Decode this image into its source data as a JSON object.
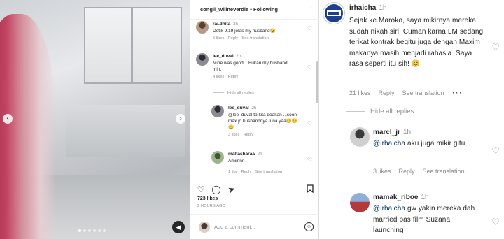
{
  "post": {
    "author": "congli_willneverdie",
    "follow_label": "Following",
    "likes": "723 likes",
    "date": "2 HOURS AGO",
    "add_comment_placeholder": "Add a comment...",
    "media_dot_count": 6,
    "comments": [
      {
        "username": "rai.dhita",
        "time": "2h",
        "text": "Detik 9.19 jelas my husband😉",
        "likes": "5 likes",
        "reply": "Reply",
        "see_translation": "See translation"
      },
      {
        "username": "lee_duval",
        "time": "2h",
        "text": "Mine was good... Bukan my husband, min.",
        "likes": "4 likes",
        "reply": "Reply"
      },
      {
        "username": "lee_duval",
        "time": "2h",
        "text": "@lee_duval tp kita doakan ...soon max jd husbandnya luna yaa😊😊😊",
        "likes": "3 likes",
        "reply": "Reply"
      },
      {
        "username": "maltasharaa",
        "time": "2h",
        "text": "Amiinnn",
        "likes": "1 like",
        "reply": "Reply",
        "see_translation": "See translation"
      }
    ],
    "hide_replies": "Hide all replies"
  },
  "thread": {
    "main": {
      "username": "irhaicha",
      "time": "1h",
      "text": "Sejak ke Maroko, saya mikirnya mereka sudah nikah siri. Cuman karna LM sedang terikat kontrak begitu juga dengan Maxim makanya masih menjadi rahasia. Saya rasa seperti itu sih! 😊",
      "likes": "21 likes",
      "reply": "Reply",
      "see_translation": "See translation"
    },
    "hide_replies": "Hide all replies",
    "reply1": {
      "username": "marcl_jr",
      "time": "1h",
      "mention": "@irhaicha",
      "text": " aku juga mikir gitu",
      "likes": "3 likes",
      "reply": "Reply",
      "see_translation": "See translation"
    },
    "reply2": {
      "username": "mamak_riboe",
      "time": "1h",
      "mention": "@irhaicha",
      "text": " gw yakin mereka dah married pas film Suzana launching"
    }
  },
  "colors": {
    "text": "#262626",
    "muted": "#8e8e8e",
    "mention": "#00376b",
    "divider": "#dbdbdb"
  },
  "icons": [
    "more-icon",
    "heart-icon",
    "comment-icon",
    "share-icon",
    "bookmark-icon",
    "emoji-icon",
    "mute-icon",
    "chevron-left-icon",
    "chevron-right-icon"
  ]
}
